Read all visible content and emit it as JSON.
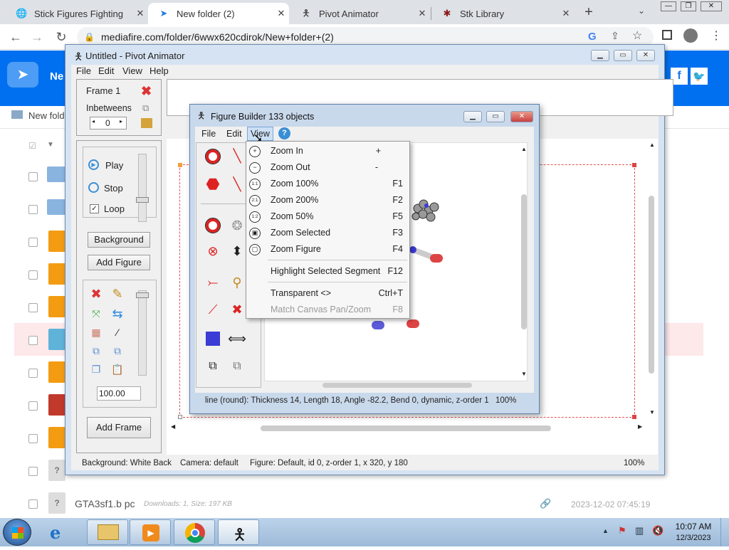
{
  "browser": {
    "tabs": [
      {
        "title": "Stick Figures Fighting",
        "icon": "globe-icon",
        "close": "✕"
      },
      {
        "title": "New folder (2)",
        "icon": "mediafire-icon",
        "close": "✕",
        "active": true
      },
      {
        "title": "Pivot Animator",
        "icon": "stick-figure-icon",
        "close": "✕"
      },
      {
        "title": "Stk Library",
        "icon": "spider-icon",
        "close": "✕"
      }
    ],
    "new_tab": "+",
    "url": "mediafire.com/folder/6wwx620cdirok/New+folder+(2)"
  },
  "mediafire": {
    "header_text": "Ne",
    "breadcrumb": "New fold",
    "files": [
      {
        "name": "GTA3sf1.b pc",
        "meta": "Downloads: 1, Size: 197 KB",
        "date": "2023-12-02 07:45:19"
      }
    ]
  },
  "pivot": {
    "title": "Untitled - Pivot Animator",
    "menu": [
      "File",
      "Edit",
      "View",
      "Help"
    ],
    "frame_label": "Frame 1",
    "inbetweens_label": "Inbetweens",
    "inbetweens_value": "0",
    "play": "Play",
    "stop": "Stop",
    "loop": "Loop",
    "background_btn": "Background",
    "add_figure_btn": "Add Figure",
    "scale_value": "100.00",
    "add_frame_btn": "Add Frame",
    "status": {
      "background": "Background: White Back",
      "camera": "Camera: default",
      "figure": "Figure: Default,  id 0,  z-order 1,  x 320, y 180",
      "zoom": "100%"
    }
  },
  "figure_builder": {
    "title": "Figure Builder  133 objects",
    "menu": [
      "File",
      "Edit",
      "View"
    ],
    "status": "line (round): Thickness 14, Length 18, Angle -82.2, Bend 0, dynamic, z-order 1",
    "zoom": "100%",
    "view_menu": [
      {
        "label": "Zoom In",
        "shortcut": "+",
        "icon": "zoom-in-icon",
        "glyph": "+"
      },
      {
        "label": "Zoom Out",
        "shortcut": "-",
        "icon": "zoom-out-icon",
        "glyph": "−"
      },
      {
        "label": "Zoom 100%",
        "shortcut": "F1",
        "icon": "zoom-100-icon",
        "glyph": "1:1"
      },
      {
        "label": "Zoom 200%",
        "shortcut": "F2",
        "icon": "zoom-200-icon",
        "glyph": "2:1"
      },
      {
        "label": "Zoom 50%",
        "shortcut": "F5",
        "icon": "zoom-50-icon",
        "glyph": "1:2"
      },
      {
        "label": "Zoom Selected",
        "shortcut": "F3",
        "icon": "zoom-selected-icon",
        "glyph": "▣"
      },
      {
        "label": "Zoom Figure",
        "shortcut": "F4",
        "icon": "zoom-figure-icon",
        "glyph": "▢"
      },
      {
        "label": "Highlight Selected Segment",
        "shortcut": "F12"
      },
      {
        "label": "Transparent <>",
        "shortcut": "Ctrl+T"
      },
      {
        "label": "Match Canvas Pan/Zoom",
        "shortcut": "F8",
        "disabled": true
      }
    ]
  },
  "taskbar": {
    "time": "10:07 AM",
    "date": "12/3/2023"
  },
  "colors": {
    "mediafire_blue": "#0070f0",
    "titlebar": "#d6e3f2",
    "taskbar": "#9dbad8",
    "close_red": "#c94040"
  }
}
